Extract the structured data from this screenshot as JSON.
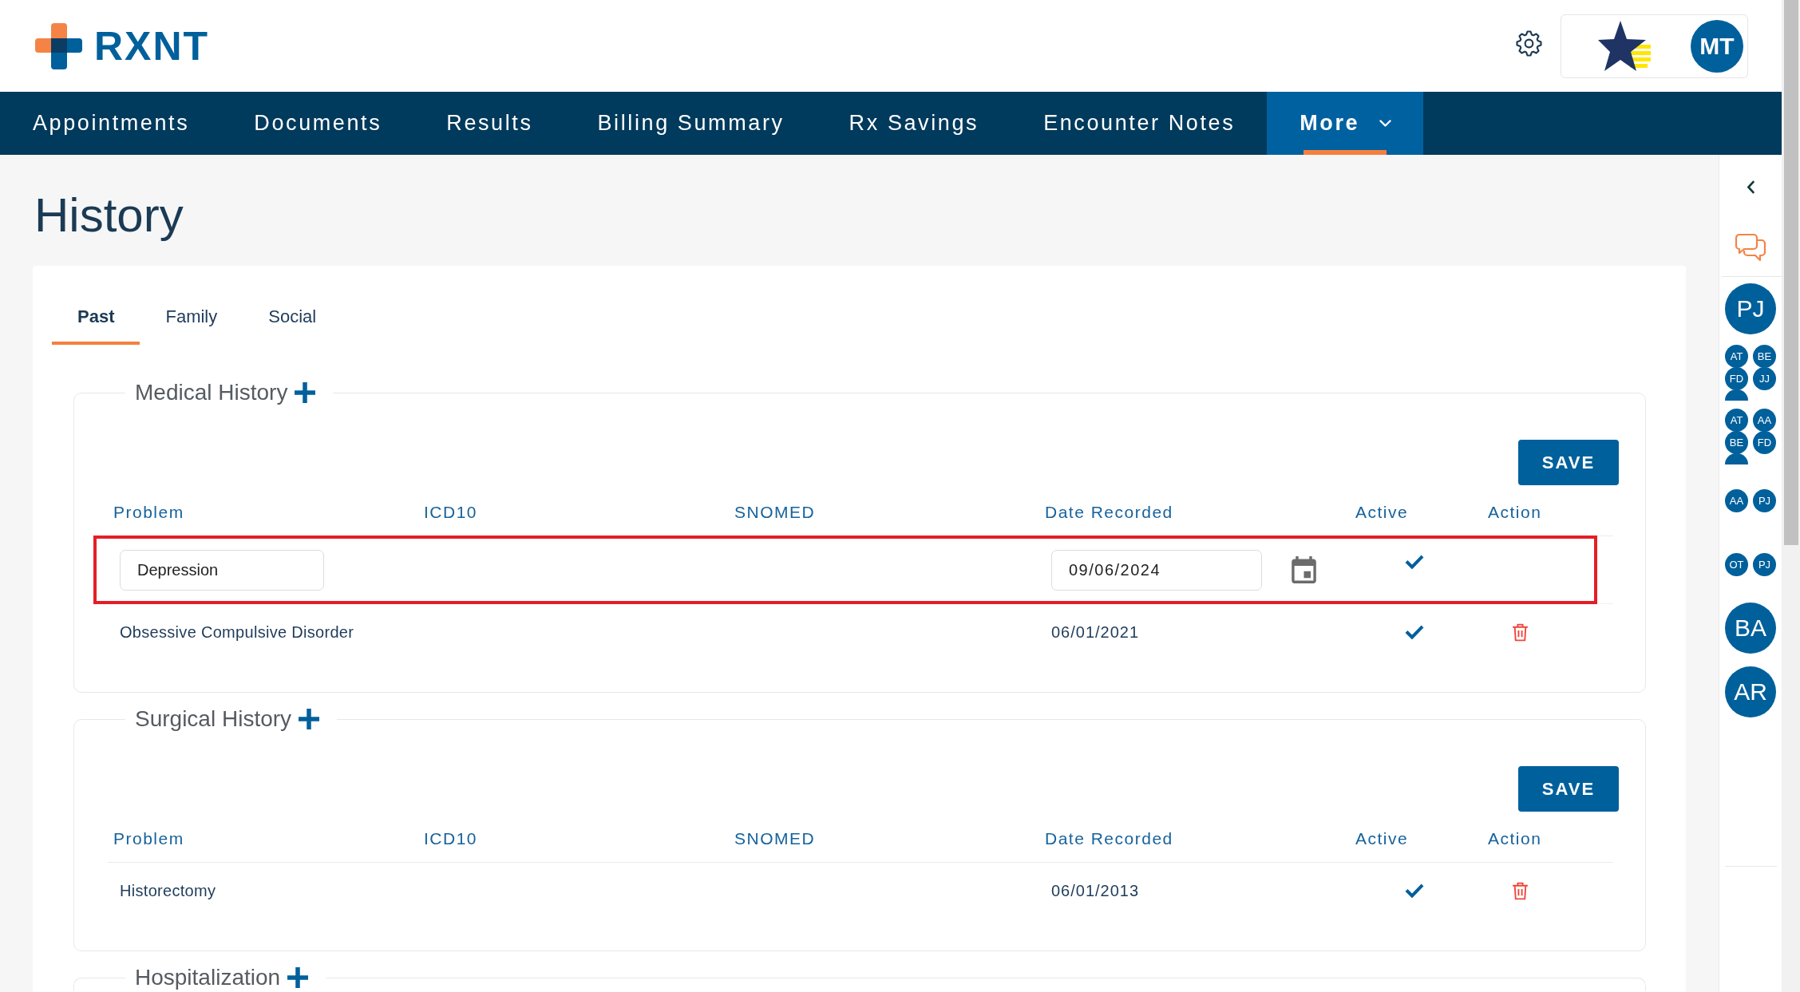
{
  "header": {
    "logo_text": "RXNT",
    "user_initials": "MT"
  },
  "nav": [
    {
      "label": "Appointments",
      "kind": "link",
      "selected": false
    },
    {
      "label": "Documents",
      "kind": "link",
      "selected": false
    },
    {
      "label": "Results",
      "kind": "link",
      "selected": false
    },
    {
      "label": "Billing Summary",
      "kind": "link",
      "selected": false
    },
    {
      "label": "Rx Savings",
      "kind": "link",
      "selected": false
    },
    {
      "label": "Encounter Notes",
      "kind": "link",
      "selected": false
    },
    {
      "label": "More",
      "kind": "dropdown",
      "selected": true
    }
  ],
  "page_title": "History",
  "tabs": [
    {
      "label": "Past",
      "selected": true
    },
    {
      "label": "Family",
      "selected": false
    },
    {
      "label": "Social",
      "selected": false
    }
  ],
  "sections": [
    {
      "title": "Medical History",
      "save_button": "SAVE",
      "columns": [
        "Problem",
        "ICD10",
        "SNOMED",
        "Date Recorded",
        "Active",
        "Action"
      ],
      "rows": [
        {
          "kind": "edit",
          "problem": "Depression",
          "date_recorded": "09/06/2024",
          "active": true,
          "highlighted": true
        },
        {
          "kind": "view",
          "problem": "Obsessive Compulsive Disorder",
          "date_recorded": "06/01/2021",
          "active": true,
          "highlighted": false
        }
      ]
    },
    {
      "title": "Surgical History",
      "save_button": "SAVE",
      "columns": [
        "Problem",
        "ICD10",
        "SNOMED",
        "Date Recorded",
        "Active",
        "Action"
      ],
      "rows": [
        {
          "kind": "view",
          "problem": "Historectomy",
          "date_recorded": "06/01/2013",
          "active": true,
          "highlighted": false
        }
      ]
    },
    {
      "title": "Hospitalization"
    }
  ],
  "sidebar": {
    "items": [
      {
        "kind": "avatar",
        "initials": "PJ"
      },
      {
        "kind": "group",
        "members": [
          "AT",
          "BE",
          "FD",
          "JJ"
        ],
        "overflow": true
      },
      {
        "kind": "group",
        "members": [
          "AT",
          "AA",
          "BE",
          "FD"
        ],
        "overflow": true
      },
      {
        "kind": "group",
        "members": [
          "AA",
          "PJ"
        ],
        "overflow": false
      },
      {
        "kind": "group",
        "members": [
          "OT",
          "PJ"
        ],
        "overflow": false
      },
      {
        "kind": "avatar",
        "initials": "BA"
      },
      {
        "kind": "avatar",
        "initials": "AR"
      }
    ]
  }
}
